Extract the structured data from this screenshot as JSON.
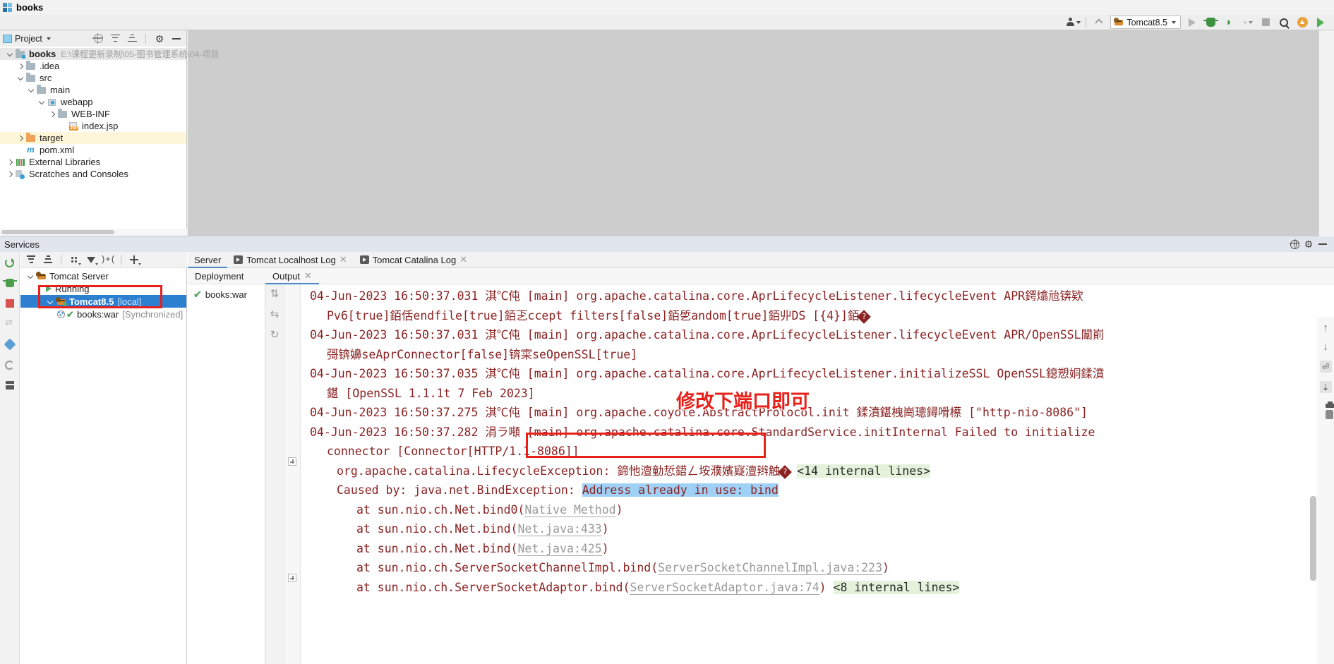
{
  "window": {
    "title": "books",
    "logo_icon": "intellij-logo-icon"
  },
  "toolbar": {
    "user_icon": "user-avatar-icon",
    "back_icon": "chevron-up-icon",
    "run_config": {
      "label": "Tomcat8.5",
      "icon": "tomcat-icon",
      "caret_icon": "chevron-down-icon"
    },
    "run_icon": "run-play-icon",
    "debug_icon": "debug-bug-icon",
    "run_with_coverage_icon": "run-coverage-icon",
    "profile_icon": "profiler-icon",
    "stop_icon": "stop-square-icon",
    "search_icon": "search-magnifier-icon",
    "update_icon": "update-arrow-icon",
    "next_icon": "green-triangle-icon"
  },
  "project_panel": {
    "title": "Project",
    "title_icon": "project-view-icon",
    "caret_icon": "chevron-down-icon",
    "locate_icon": "scroll-from-source-icon",
    "expand_icon": "expand-all-icon",
    "collapse_icon": "collapse-all-icon",
    "settings_icon": "gear-icon",
    "hide_icon": "minimize-icon",
    "tree": [
      {
        "label": "books",
        "path": "E:\\课程更新录制\\05-图书管理系统\\04-项目",
        "icon": "module-icon",
        "arrow": "down",
        "indent": 0,
        "bold": true,
        "state": "root"
      },
      {
        "label": ".idea",
        "icon": "folder-icon",
        "arrow": "right",
        "indent": 1
      },
      {
        "label": "src",
        "icon": "folder-icon",
        "arrow": "down",
        "indent": 1
      },
      {
        "label": "main",
        "icon": "folder-icon",
        "arrow": "down",
        "indent": 2
      },
      {
        "label": "webapp",
        "icon": "web-folder-icon",
        "arrow": "down",
        "indent": 3
      },
      {
        "label": "WEB-INF",
        "icon": "folder-icon",
        "arrow": "right",
        "indent": 4
      },
      {
        "label": "index.jsp",
        "icon": "jsp-file-icon",
        "arrow": "none",
        "indent": 5
      },
      {
        "label": "target",
        "icon": "folder-orange-icon",
        "arrow": "right",
        "indent": 1,
        "state": "highlight"
      },
      {
        "label": "pom.xml",
        "icon": "maven-file-icon",
        "arrow": "none",
        "indent": 1
      },
      {
        "label": "External Libraries",
        "icon": "libraries-icon",
        "arrow": "right",
        "indent": 0
      },
      {
        "label": "Scratches and Consoles",
        "icon": "scratches-icon",
        "arrow": "right",
        "indent": 0
      }
    ]
  },
  "services": {
    "title": "Services",
    "settings_icon": "gear-icon",
    "help_icon": "globe-icon",
    "hide_icon": "minimize-icon",
    "left_gutter_icons": [
      "rerun-icon",
      "debug-icon",
      "stop-icon",
      "resume-icon",
      "filter-icon",
      "restart-icon",
      "layout-icon"
    ],
    "toolbar_icons": [
      "expand-all-icon",
      "collapse-all-icon",
      "group-by-icon",
      "filter-icon",
      "add-tab-icon",
      "add-icon"
    ],
    "tree": [
      {
        "label": "Tomcat Server",
        "icon": "tomcat-icon",
        "arrow": "down",
        "indent": 0
      },
      {
        "label": "Running",
        "icon": "running-icon",
        "arrow": "right",
        "indent": 1
      },
      {
        "label": "Tomcat8.5",
        "suffix": "[local]",
        "icon": "tomcat-running-icon",
        "arrow": "down",
        "indent": 2,
        "selected": true,
        "bold": true
      },
      {
        "label": "books:war",
        "suffix": "[Synchronized]",
        "icon": "war-artifact-icon",
        "arrow": "none",
        "indent": 3
      }
    ]
  },
  "tabs": [
    {
      "label": "Server",
      "icon": "none",
      "active": true,
      "closable": false
    },
    {
      "label": "Tomcat Localhost Log",
      "icon": "run-console-icon",
      "active": false,
      "closable": true
    },
    {
      "label": "Tomcat Catalina Log",
      "icon": "run-console-icon",
      "active": false,
      "closable": true
    }
  ],
  "subtabs": [
    {
      "label": "Deployment",
      "active": false,
      "closable": false
    },
    {
      "label": "Output",
      "active": true,
      "closable": true
    }
  ],
  "deployment": {
    "item_label": "books:war",
    "status_icon": "green-check-icon",
    "side_icons": [
      "deploy-arrows-icon",
      "undeploy-arrows-icon",
      "redeploy-icon"
    ]
  },
  "annotations": {
    "chinese_note": "修改下端口即可",
    "note_color": "#e8201a",
    "box_color": "#e8201a"
  },
  "output_right_toolbar": [
    "scroll-up-icon",
    "scroll-down-icon",
    "soft-wrap-icon",
    "scroll-to-end-icon",
    "print-icon",
    "clear-all-icon"
  ],
  "log": {
    "lines": [
      {
        "id": "l1",
        "text": "04-Jun-2023 16:50:37.031 淇℃伅 [main] org.apache.catalina.core.AprLifecycleListener.lifecycleEvent APR鍔熻兘锛欵",
        "indent": 0
      },
      {
        "id": "l2",
        "text": "Pv6[true]銆佸endfile[true]銆乤ccept filters[false]銆乺andom[true]銆丱DS [{4}]銆",
        "indent": 1,
        "tail_qmark": true
      },
      {
        "id": "l3",
        "text": "04-Jun-2023 16:50:37.031 淇℃伅 [main] org.apache.catalina.core.AprLifecycleListener.lifecycleEvent APR/OpenSSL闈崱",
        "indent": 0
      },
      {
        "id": "l4",
        "text": "彁锛嬶seAprConnector[false]锛寀seOpenSSL[true]",
        "indent": 1
      },
      {
        "id": "l5",
        "text": "04-Jun-2023 16:50:37.035 淇℃伅 [main] org.apache.catalina.core.AprLifecycleListener.initializeSSL OpenSSL鎴愬姛鍒濆",
        "indent": 0
      },
      {
        "id": "l6",
        "text": "鍖 [OpenSSL 1.1.1t  7 Feb 2023]",
        "indent": 1,
        "lead_qmark": true
      },
      {
        "id": "l7",
        "text": "04-Jun-2023 16:50:37.275 淇℃伅 [main] org.apache.coyote.AbstractProtocol.init 鍒濆鍖栧崗璁鐞嗗櫒 [\"http-nio-8086\"]",
        "indent": 0
      },
      {
        "id": "l8",
        "text": "04-Jun-2023 16:50:37.282 涓ラ噸 [main] org.apache.catalina.core.StandardService.initInternal Failed to initialize",
        "indent": 0
      },
      {
        "id": "l9",
        "text": "connector [Connector[HTTP/1.1-8086]]",
        "indent": 1
      },
      {
        "id": "l10",
        "text": "org.apache.catalina.LifecycleException: 鍗忚澶勭悊鍣ㄥ垵濮嬪寲澶辫触",
        "indent": 2,
        "fold": true,
        "suffix_green": "<14 internal lines>",
        "tail_qmark": true
      },
      {
        "id": "l11",
        "text": "Caused by: java.net.BindException: ",
        "highlight_text": "Address already in use: bind",
        "indent": 2
      },
      {
        "id": "l12",
        "text": "at sun.nio.ch.Net.bind0(",
        "link": "Native Method",
        "close": ")",
        "indent": 3
      },
      {
        "id": "l13",
        "text": "at sun.nio.ch.Net.bind(",
        "link": "Net.java:433",
        "close": ")",
        "indent": 3
      },
      {
        "id": "l14",
        "text": "at sun.nio.ch.Net.bind(",
        "link": "Net.java:425",
        "close": ")",
        "indent": 3
      },
      {
        "id": "l15",
        "text": "at sun.nio.ch.ServerSocketChannelImpl.bind(",
        "link": "ServerSocketChannelImpl.java:223",
        "close": ")",
        "indent": 3
      },
      {
        "id": "l16",
        "text": "at sun.nio.ch.ServerSocketAdaptor.bind(",
        "link": "ServerSocketAdaptor.java:74",
        "close": ")",
        "indent": 3,
        "fold": true,
        "suffix_green": "<8 internal lines>"
      }
    ]
  }
}
